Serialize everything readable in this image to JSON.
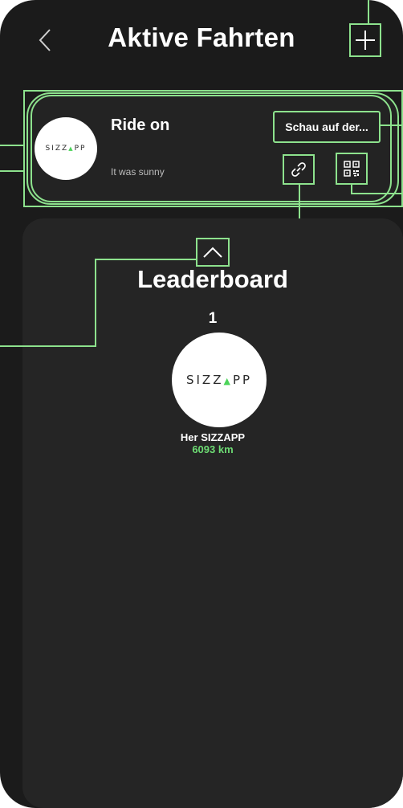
{
  "header": {
    "title": "Aktive Fahrten",
    "back_icon": "chevron-left-icon",
    "add_icon": "plus-icon"
  },
  "ride_card": {
    "title": "Ride on",
    "subtitle": "It was sunny",
    "logo": {
      "prefix": "SIZZ",
      "arrow": "▲",
      "suffix": "PP"
    },
    "view_button_label": "Schau auf der...",
    "link_icon": "link-icon",
    "qr_icon": "qr-code-icon"
  },
  "leaderboard": {
    "title": "Leaderboard",
    "collapse_icon": "chevron-up-icon",
    "entries": [
      {
        "rank": "1",
        "name": "Her SIZZAPP",
        "distance": "6093 km",
        "logo": {
          "prefix": "SIZZ",
          "arrow": "▲",
          "suffix": "PP"
        }
      }
    ]
  },
  "colors": {
    "background": "#1b1b1b",
    "panel": "#252525",
    "card": "#232323",
    "annotation_green": "#8de28d",
    "distance_green": "#6ddb73",
    "logo_arrow_green": "#4cd45a"
  }
}
